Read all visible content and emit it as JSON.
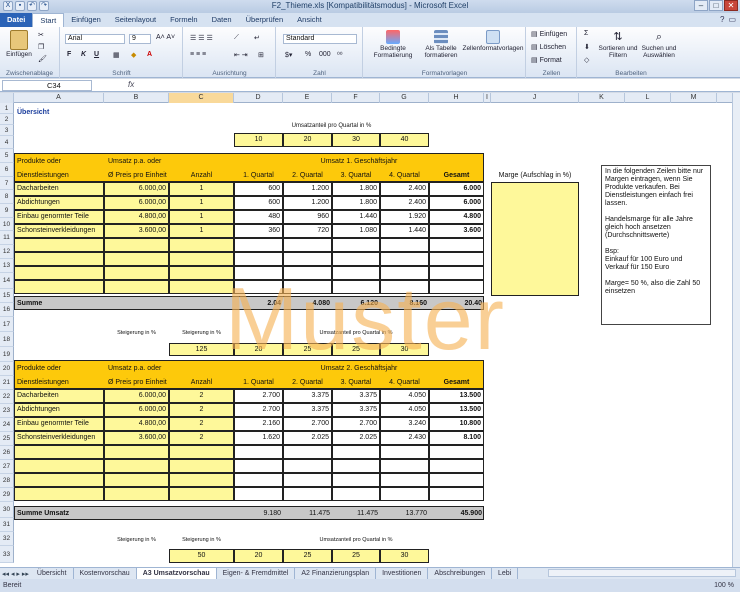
{
  "window": {
    "title": "F2_Thieme.xls [Kompatibilitätsmodus] - Microsoft Excel",
    "minimize": "–",
    "maximize": "□",
    "close": "✕"
  },
  "ribbon_tabs": [
    "Datei",
    "Start",
    "Einfügen",
    "Seitenlayout",
    "Formeln",
    "Daten",
    "Überprüfen",
    "Ansicht"
  ],
  "ribbon": {
    "clipboard": {
      "paste": "Einfügen",
      "label": "Zwischenablage"
    },
    "font": {
      "name": "Arial",
      "size": "9",
      "label": "Schrift",
      "bold": "F",
      "italic": "K",
      "underline": "U"
    },
    "alignment": {
      "label": "Ausrichtung"
    },
    "number": {
      "format": "Standard",
      "label": "Zahl",
      "percent": "%",
      "thousands": "000"
    },
    "styles": {
      "cond": "Bedingte Formatierung",
      "table": "Als Tabelle formatieren",
      "cell": "Zellenformatvorlagen",
      "label": "Formatvorlagen"
    },
    "cells": {
      "insert": "Einfügen",
      "delete": "Löschen",
      "format": "Format",
      "label": "Zellen"
    },
    "editing": {
      "sort": "Sortieren und Filtern",
      "find": "Suchen und Auswählen",
      "label": "Bearbeiten",
      "sum": "Σ"
    }
  },
  "formula_bar": {
    "cell_ref": "C34",
    "fx": "fx",
    "value": ""
  },
  "columns": [
    "A",
    "B",
    "C",
    "D",
    "E",
    "F",
    "G",
    "H",
    "I",
    "J",
    "K",
    "L",
    "M"
  ],
  "rows": [
    "1",
    "2",
    "3",
    "4",
    "5",
    "6",
    "7",
    "8",
    "9",
    "10",
    "11",
    "12",
    "13",
    "14",
    "15",
    "16",
    "17",
    "18",
    "19",
    "20",
    "21",
    "22",
    "23",
    "24",
    "25",
    "26",
    "27",
    "28",
    "29",
    "30",
    "31",
    "32",
    "33"
  ],
  "sheet": {
    "a1": "Übersicht",
    "r2": "Umsatzanteil pro Quartal in %",
    "r3": [
      "10",
      "20",
      "30",
      "40"
    ],
    "hdr1": {
      "prod": "Produkte oder",
      "umsatz": "Umsatz p.a. oder",
      "year": "Umsatz 1. Geschäftsjahr",
      "dl": "Dienstleistungen",
      "price": "Ø Preis pro Einheit",
      "anz": "Anzahl",
      "q1": "1. Quartal",
      "q2": "2. Quartal",
      "q3": "3. Quartal",
      "q4": "4. Quartal",
      "ges": "Gesamt",
      "marge": "Marge (Aufschlag in %)"
    },
    "block1": [
      [
        "Dacharbeiten",
        "6.000,00",
        "1",
        "600",
        "1.200",
        "1.800",
        "2.400",
        "6.000"
      ],
      [
        "Abdichtungen",
        "6.000,00",
        "1",
        "600",
        "1.200",
        "1.800",
        "2.400",
        "6.000"
      ],
      [
        "Einbau genormter Teile",
        "4.800,00",
        "1",
        "480",
        "960",
        "1.440",
        "1.920",
        "4.800"
      ],
      [
        "Schonsteinverkleidungen",
        "3.600,00",
        "1",
        "360",
        "720",
        "1.080",
        "1.440",
        "3.600"
      ]
    ],
    "summe1": {
      "label": "Summe",
      "q1": "2.04",
      "q2": "4.080",
      "q3": "6.120",
      "q4": "8.160",
      "ges": "20.40"
    },
    "r17": {
      "stb": "Steigerung in %",
      "stc": "Steigerung in %",
      "umq": "Umsatzanteil pro Quartal in %"
    },
    "r18": [
      "125",
      "20",
      "25",
      "25",
      "30"
    ],
    "hdr2": {
      "year": "Umsatz 2. Geschäftsjahr"
    },
    "block2": [
      [
        "Dacharbeiten",
        "6.000,00",
        "2",
        "2.700",
        "3.375",
        "3.375",
        "4.050",
        "13.500"
      ],
      [
        "Abdichtungen",
        "6.000,00",
        "2",
        "2.700",
        "3.375",
        "3.375",
        "4.050",
        "13.500"
      ],
      [
        "Einbau genormter Teile",
        "4.800,00",
        "2",
        "2.160",
        "2.700",
        "2.700",
        "3.240",
        "10.800"
      ],
      [
        "Schonsteinverkleidungen",
        "3.600,00",
        "2",
        "1.620",
        "2.025",
        "2.025",
        "2.430",
        "8.100"
      ]
    ],
    "summe2": {
      "label": "Summe Umsatz",
      "q1": "9.180",
      "q2": "11.475",
      "q3": "11.475",
      "q4": "13.770",
      "ges": "45.900"
    },
    "r32": {
      "stb": "Steigerung in %",
      "stc": "Steigerung in %",
      "umq": "Umsatzanteil pro Quartal in %"
    },
    "r33": [
      "50",
      "20",
      "25",
      "25",
      "30"
    ],
    "note": "In die folgenden Zeilen bitte nur Margen eintragen, wenn Sie Produkte verkaufen. Bei Dienstleistungen einfach frei lassen.\n\nHandelsmarge für alle Jahre gleich hoch ansetzen (Durchschnittswerte)\n\nBsp:\nEinkauf für 100 Euro und Verkauf für 150 Euro\n\nMarge= 50 %, also die Zahl 50 einsetzen",
    "watermark": "Muster"
  },
  "sheet_tabs": [
    "Übersicht",
    "Kostenvorschau",
    "A3 Umsatzvorschau",
    "Eigen- & Fremdmittel",
    "A2 Finanzierungsplan",
    "Investitionen",
    "Abschreibungen",
    "Lebi"
  ],
  "status": {
    "left": "Bereit",
    "zoom": "100 %"
  }
}
